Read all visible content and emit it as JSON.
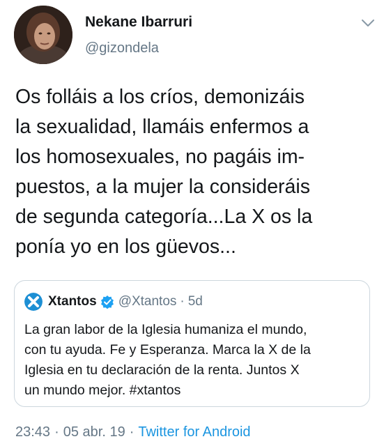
{
  "author": {
    "name": "Nekane Ibarruri",
    "handle": "@gizondela"
  },
  "icons": {
    "caret": "chevron-down-icon",
    "quote_avatar": "xtantos-logo",
    "verified": "verified-badge-icon"
  },
  "tweet": {
    "lines": [
      "Os folláis a los críos, demonizáis",
      "la sexualidad, llamáis enfermos a",
      "los homosexuales, no pagáis im-",
      "puestos, a la mujer la consideráis",
      "de segunda categoría...La X os la",
      "ponía yo en los güevos..."
    ]
  },
  "quote": {
    "name": "Xtantos",
    "handle": "@Xtantos",
    "dot": "·",
    "time": "5d",
    "lines": [
      "La gran labor de la Iglesia humaniza el mundo,",
      "con tu ayuda. Fe y Esperanza. Marca la X de la",
      "Iglesia en tu declaración de la renta. Juntos X",
      "un mundo mejor. #xtantos"
    ]
  },
  "meta": {
    "time": "23:43",
    "sep1": "·",
    "date": "05 abr. 19",
    "sep2": "·",
    "source": "Twitter for Android"
  },
  "colors": {
    "text": "#14171a",
    "secondary": "#657786",
    "link": "#1b95e0",
    "border": "#ccd6dd",
    "xtantos_blue": "#1d8fd4"
  }
}
